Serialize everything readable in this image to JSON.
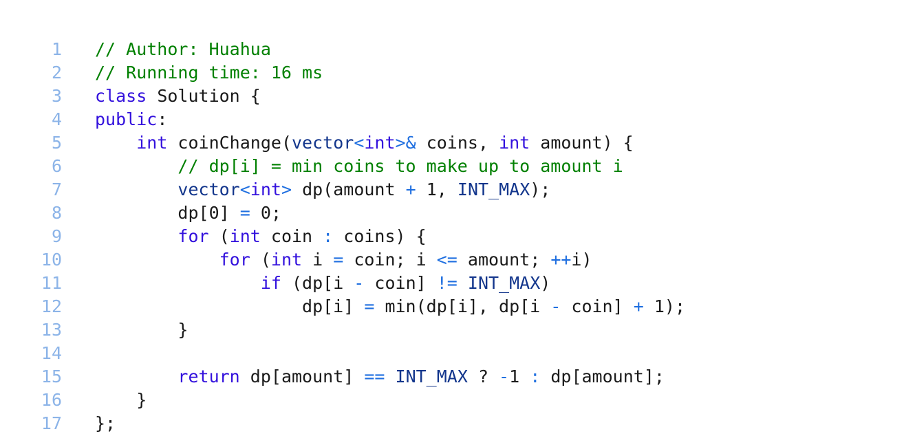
{
  "editor": {
    "background_color": "#ffffff",
    "language": "cpp",
    "gutter": {
      "color": "#8cb4e8",
      "numbers": [
        "1",
        "2",
        "3",
        "4",
        "5",
        "6",
        "7",
        "8",
        "9",
        "10",
        "11",
        "12",
        "13",
        "14",
        "15",
        "16",
        "17"
      ]
    },
    "palette": {
      "plain": "#1a1a1a",
      "comment": "#008000",
      "keyword": "#3311dd",
      "type": "#13368c",
      "constant": "#13368c",
      "operator": "#1f6fe0",
      "number": "#1a1a1a",
      "line_number": "#8cb4e8"
    },
    "plain_text": [
      "// Author: Huahua",
      "// Running time: 16 ms",
      "class Solution {",
      "public:",
      "    int coinChange(vector<int>& coins, int amount) {",
      "        // dp[i] = min coins to make up to amount i",
      "        vector<int> dp(amount + 1, INT_MAX);",
      "        dp[0] = 0;",
      "        for (int coin : coins) {",
      "            for (int i = coin; i <= amount; ++i)",
      "                if (dp[i - coin] != INT_MAX)",
      "                    dp[i] = min(dp[i], dp[i - coin] + 1);",
      "        }",
      "",
      "        return dp[amount] == INT_MAX ? -1 : dp[amount];",
      "    }",
      "};"
    ],
    "lines": [
      {
        "number": "1",
        "tokens": [
          {
            "t": "// Author: Huahua",
            "c": "comment"
          }
        ]
      },
      {
        "number": "2",
        "tokens": [
          {
            "t": "// Running time: 16 ms",
            "c": "comment"
          }
        ]
      },
      {
        "number": "3",
        "tokens": [
          {
            "t": "class",
            "c": "keyword"
          },
          {
            "t": " Solution {",
            "c": "plain"
          }
        ]
      },
      {
        "number": "4",
        "tokens": [
          {
            "t": "public",
            "c": "keyword"
          },
          {
            "t": ":",
            "c": "plain"
          }
        ]
      },
      {
        "number": "5",
        "tokens": [
          {
            "t": "    ",
            "c": "plain"
          },
          {
            "t": "int",
            "c": "keyword"
          },
          {
            "t": " coinChange(",
            "c": "plain"
          },
          {
            "t": "vector",
            "c": "type"
          },
          {
            "t": "<",
            "c": "operator"
          },
          {
            "t": "int",
            "c": "keyword"
          },
          {
            "t": ">&",
            "c": "operator"
          },
          {
            "t": " coins, ",
            "c": "plain"
          },
          {
            "t": "int",
            "c": "keyword"
          },
          {
            "t": " amount) {",
            "c": "plain"
          }
        ]
      },
      {
        "number": "6",
        "tokens": [
          {
            "t": "        ",
            "c": "plain"
          },
          {
            "t": "// dp[i] = min coins to make up to amount i",
            "c": "comment"
          }
        ]
      },
      {
        "number": "7",
        "tokens": [
          {
            "t": "        ",
            "c": "plain"
          },
          {
            "t": "vector",
            "c": "type"
          },
          {
            "t": "<",
            "c": "operator"
          },
          {
            "t": "int",
            "c": "keyword"
          },
          {
            "t": ">",
            "c": "operator"
          },
          {
            "t": " dp(amount ",
            "c": "plain"
          },
          {
            "t": "+",
            "c": "operator"
          },
          {
            "t": " ",
            "c": "plain"
          },
          {
            "t": "1",
            "c": "number"
          },
          {
            "t": ", ",
            "c": "plain"
          },
          {
            "t": "INT_MAX",
            "c": "const"
          },
          {
            "t": ");",
            "c": "plain"
          }
        ]
      },
      {
        "number": "8",
        "tokens": [
          {
            "t": "        dp[",
            "c": "plain"
          },
          {
            "t": "0",
            "c": "number"
          },
          {
            "t": "] ",
            "c": "plain"
          },
          {
            "t": "=",
            "c": "operator"
          },
          {
            "t": " ",
            "c": "plain"
          },
          {
            "t": "0",
            "c": "number"
          },
          {
            "t": ";",
            "c": "plain"
          }
        ]
      },
      {
        "number": "9",
        "tokens": [
          {
            "t": "        ",
            "c": "plain"
          },
          {
            "t": "for",
            "c": "keyword"
          },
          {
            "t": " (",
            "c": "plain"
          },
          {
            "t": "int",
            "c": "keyword"
          },
          {
            "t": " coin ",
            "c": "plain"
          },
          {
            "t": ":",
            "c": "operator"
          },
          {
            "t": " coins) {",
            "c": "plain"
          }
        ]
      },
      {
        "number": "10",
        "tokens": [
          {
            "t": "            ",
            "c": "plain"
          },
          {
            "t": "for",
            "c": "keyword"
          },
          {
            "t": " (",
            "c": "plain"
          },
          {
            "t": "int",
            "c": "keyword"
          },
          {
            "t": " i ",
            "c": "plain"
          },
          {
            "t": "=",
            "c": "operator"
          },
          {
            "t": " coin; i ",
            "c": "plain"
          },
          {
            "t": "<=",
            "c": "operator"
          },
          {
            "t": " amount; ",
            "c": "plain"
          },
          {
            "t": "++",
            "c": "operator"
          },
          {
            "t": "i)",
            "c": "plain"
          }
        ]
      },
      {
        "number": "11",
        "tokens": [
          {
            "t": "                ",
            "c": "plain"
          },
          {
            "t": "if",
            "c": "keyword"
          },
          {
            "t": " (dp[i ",
            "c": "plain"
          },
          {
            "t": "-",
            "c": "operator"
          },
          {
            "t": " coin] ",
            "c": "plain"
          },
          {
            "t": "!=",
            "c": "operator"
          },
          {
            "t": " ",
            "c": "plain"
          },
          {
            "t": "INT_MAX",
            "c": "const"
          },
          {
            "t": ")",
            "c": "plain"
          }
        ]
      },
      {
        "number": "12",
        "tokens": [
          {
            "t": "                    dp[i] ",
            "c": "plain"
          },
          {
            "t": "=",
            "c": "operator"
          },
          {
            "t": " min(dp[i], dp[i ",
            "c": "plain"
          },
          {
            "t": "-",
            "c": "operator"
          },
          {
            "t": " coin] ",
            "c": "plain"
          },
          {
            "t": "+",
            "c": "operator"
          },
          {
            "t": " ",
            "c": "plain"
          },
          {
            "t": "1",
            "c": "number"
          },
          {
            "t": ");",
            "c": "plain"
          }
        ]
      },
      {
        "number": "13",
        "tokens": [
          {
            "t": "        }",
            "c": "plain"
          }
        ]
      },
      {
        "number": "14",
        "tokens": [
          {
            "t": "",
            "c": "plain"
          }
        ]
      },
      {
        "number": "15",
        "tokens": [
          {
            "t": "        ",
            "c": "plain"
          },
          {
            "t": "return",
            "c": "keyword"
          },
          {
            "t": " dp[amount] ",
            "c": "plain"
          },
          {
            "t": "==",
            "c": "operator"
          },
          {
            "t": " ",
            "c": "plain"
          },
          {
            "t": "INT_MAX",
            "c": "const"
          },
          {
            "t": " ? ",
            "c": "plain"
          },
          {
            "t": "-",
            "c": "operator"
          },
          {
            "t": "1",
            "c": "number"
          },
          {
            "t": " ",
            "c": "plain"
          },
          {
            "t": ":",
            "c": "operator"
          },
          {
            "t": " dp[amount];",
            "c": "plain"
          }
        ]
      },
      {
        "number": "16",
        "tokens": [
          {
            "t": "    }",
            "c": "plain"
          }
        ]
      },
      {
        "number": "17",
        "tokens": [
          {
            "t": "};",
            "c": "plain"
          }
        ]
      }
    ]
  }
}
